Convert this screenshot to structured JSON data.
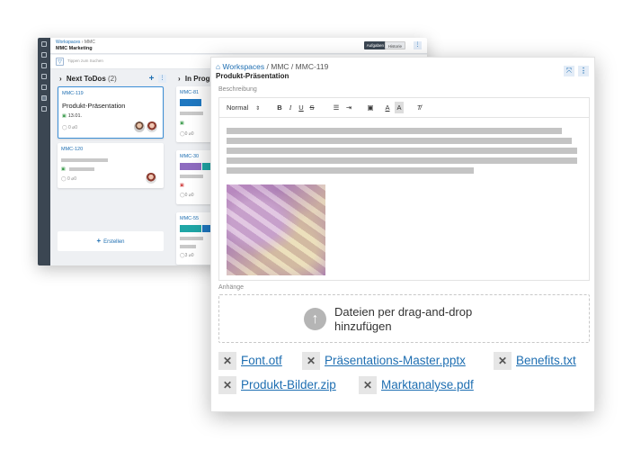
{
  "back_window": {
    "breadcrumb": [
      "Workspaces",
      "MMC"
    ],
    "title": "MMC Marketing",
    "buttons": {
      "tasks": "Aufgaben",
      "history": "Historie"
    },
    "search_placeholder": "Tippen zum Suchen",
    "columns": [
      {
        "title": "Next ToDos",
        "count": "(2)"
      },
      {
        "title": "In Progr"
      }
    ],
    "cards": [
      {
        "id": "MMC-119",
        "title": "Produkt-Präsentation",
        "date": "13.01.",
        "comments": "0",
        "attachments": "0"
      },
      {
        "id": "MMC-120",
        "comments": "0",
        "attachments": "0"
      }
    ],
    "create_label": "Erstellen",
    "progress_cards": [
      {
        "id": "MMC-81",
        "comments": "0",
        "attachments": "0"
      },
      {
        "id": "MMC-30",
        "comments": "0",
        "attachments": "0"
      },
      {
        "id": "MMC-55",
        "comments": "3",
        "attachments": "0"
      }
    ]
  },
  "front_window": {
    "breadcrumb": {
      "root": "Workspaces",
      "mid": "MMC",
      "current": "MMC-119"
    },
    "title": "Produkt-Präsentation",
    "description_label": "Beschreibung",
    "editor_toolbar": {
      "style_select": "Normal"
    },
    "attachments_label": "Anhänge",
    "dropzone_text": "Dateien per drag-and-drop hinzufügen",
    "files": [
      "Font.otf",
      "Präsentations-Master.pptx",
      "Benefits.txt",
      "Produkt-Bilder.zip",
      "Marktanalyse.pdf"
    ]
  }
}
